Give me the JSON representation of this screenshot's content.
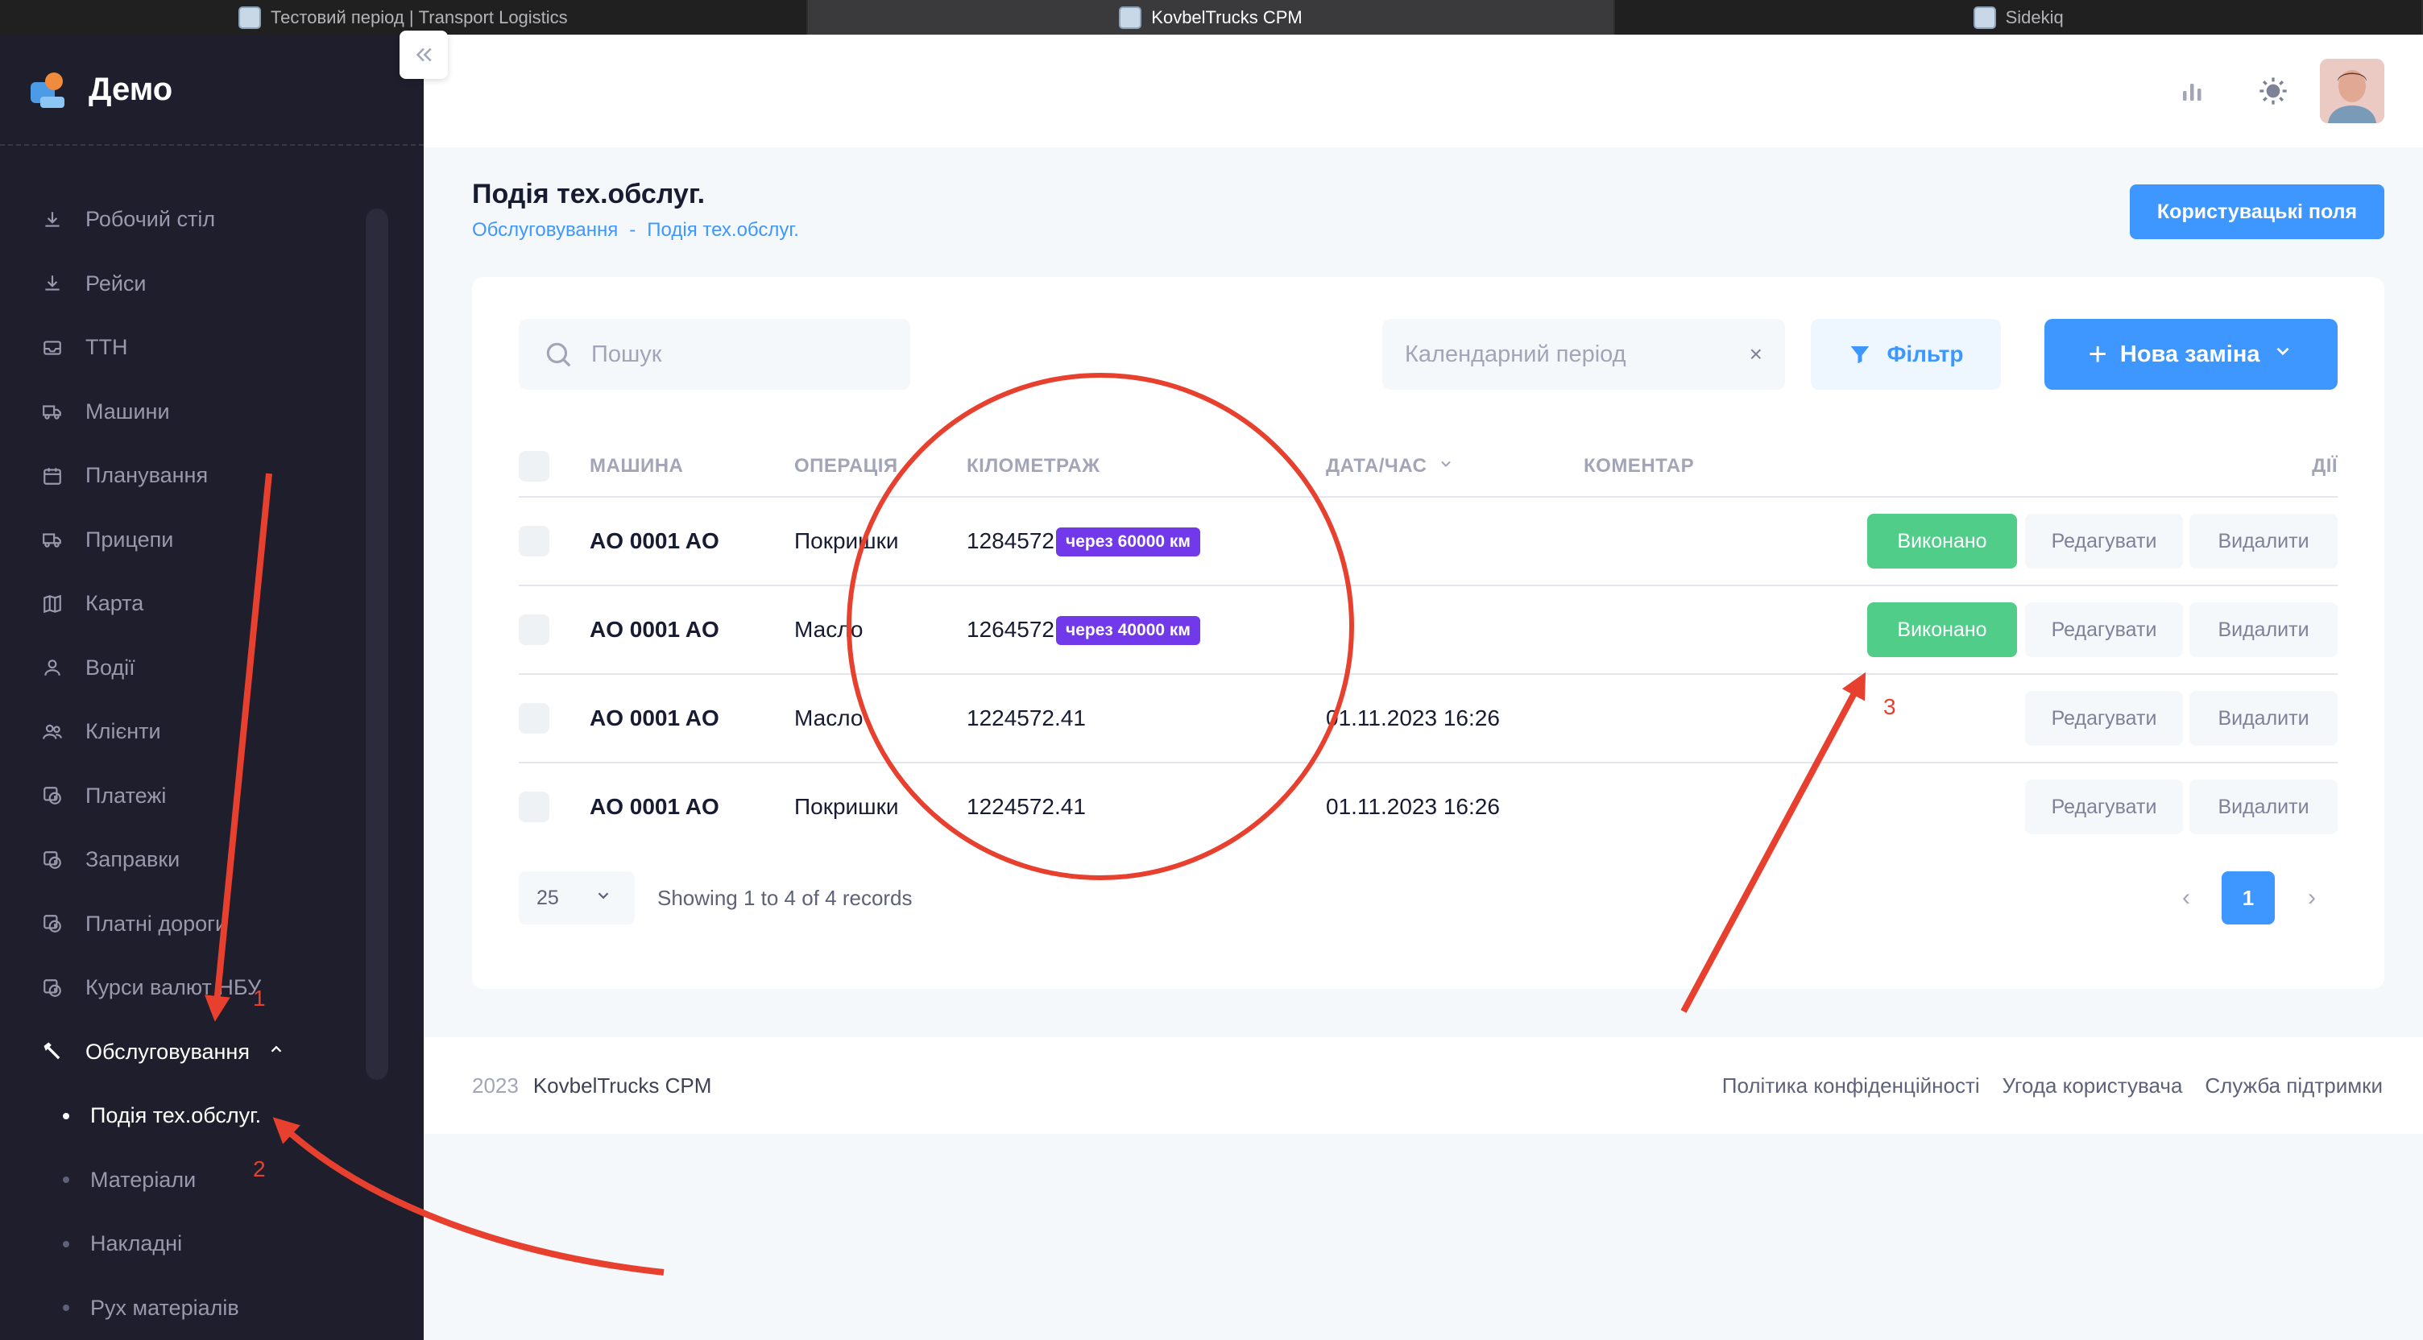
{
  "browser_tabs": [
    {
      "label": "Тестовий період | Transport Logistics",
      "active": false
    },
    {
      "label": "KovbelTrucks CPM",
      "active": true
    },
    {
      "label": "Sidekiq",
      "active": false
    }
  ],
  "sidebar": {
    "brand": "Демо",
    "collapse_icon": "double-chevron-left-icon",
    "items": [
      {
        "label": "Робочий стіл",
        "icon": "download-icon"
      },
      {
        "label": "Рейси",
        "icon": "download-icon"
      },
      {
        "label": "ТТН",
        "icon": "inbox-icon"
      },
      {
        "label": "Машини",
        "icon": "truck-icon"
      },
      {
        "label": "Планування",
        "icon": "calendar-icon"
      },
      {
        "label": "Прицепи",
        "icon": "truck-icon"
      },
      {
        "label": "Карта",
        "icon": "map-icon"
      },
      {
        "label": "Водії",
        "icon": "user-icon"
      },
      {
        "label": "Клієнти",
        "icon": "users-icon"
      },
      {
        "label": "Платежі",
        "icon": "dollar-icon"
      },
      {
        "label": "Заправки",
        "icon": "dollar-icon"
      },
      {
        "label": "Платні дороги",
        "icon": "dollar-icon"
      },
      {
        "label": "Курси валют НБУ",
        "icon": "dollar-icon"
      }
    ],
    "open_item": {
      "label": "Обслуговування",
      "icon": "hammer-icon"
    },
    "sub_items": [
      {
        "label": "Подія тех.обслуг.",
        "active": true
      },
      {
        "label": "Матеріали",
        "active": false
      },
      {
        "label": "Накладні",
        "active": false
      },
      {
        "label": "Рух матеріалів",
        "active": false
      }
    ]
  },
  "header": {
    "icons": [
      "chart-icon",
      "sun-icon"
    ],
    "avatar": "user-avatar"
  },
  "toolbar": {
    "title": "Подія тех.обслуг.",
    "breadcrumb": [
      "Обслуговування",
      "-",
      "Подія тех.обслуг."
    ],
    "custom_fields_button": "Користувацькі поля"
  },
  "filters": {
    "search_placeholder": "Пошук",
    "date_placeholder": "Календарний період",
    "date_clear": "×",
    "filter_label": "Фільтр",
    "new_label": "Нова заміна",
    "new_plus": "+",
    "new_caret": "⌄"
  },
  "table": {
    "columns": [
      "МАШИНА",
      "ОПЕРАЦІЯ",
      "КІЛОМЕТРАЖ",
      "ДАТА/ЧАС",
      "КОМЕНТАР",
      "ДІЇ"
    ],
    "sort_indicator": "⌄",
    "rows": [
      {
        "vehicle": "AO 0001 AO",
        "operation": "Покришки",
        "mileage": "1284572",
        "badge": "через 60000 км",
        "datetime": "",
        "comment": "",
        "done": "Виконано",
        "edit": "Редагувати",
        "delete": "Видалити"
      },
      {
        "vehicle": "AO 0001 AO",
        "operation": "Масло",
        "mileage": "1264572",
        "badge": "через 40000 км",
        "datetime": "",
        "comment": "",
        "done": "Виконано",
        "edit": "Редагувати",
        "delete": "Видалити"
      },
      {
        "vehicle": "AO 0001 AO",
        "operation": "Масло",
        "mileage": "1224572.41",
        "badge": "",
        "datetime": "01.11.2023 16:26",
        "comment": "",
        "done": "",
        "edit": "Редагувати",
        "delete": "Видалити"
      },
      {
        "vehicle": "AO 0001 AO",
        "operation": "Покришки",
        "mileage": "1224572.41",
        "badge": "",
        "datetime": "01.11.2023 16:26",
        "comment": "",
        "done": "",
        "edit": "Редагувати",
        "delete": "Видалити"
      }
    ]
  },
  "pagination": {
    "per_page": "25",
    "per_page_caret": "⌄",
    "info": "Showing 1 to 4 of 4 records",
    "prev": "‹",
    "current": "1",
    "next": "›"
  },
  "footer": {
    "year": "2023",
    "brand": "KovbelTrucks CPM",
    "links": [
      "Політика конфіденційності",
      "Угода користувача",
      "Служба підтримки"
    ]
  },
  "annotations": {
    "numbers": [
      "1",
      "2",
      "3"
    ],
    "color": "#e8402e"
  }
}
